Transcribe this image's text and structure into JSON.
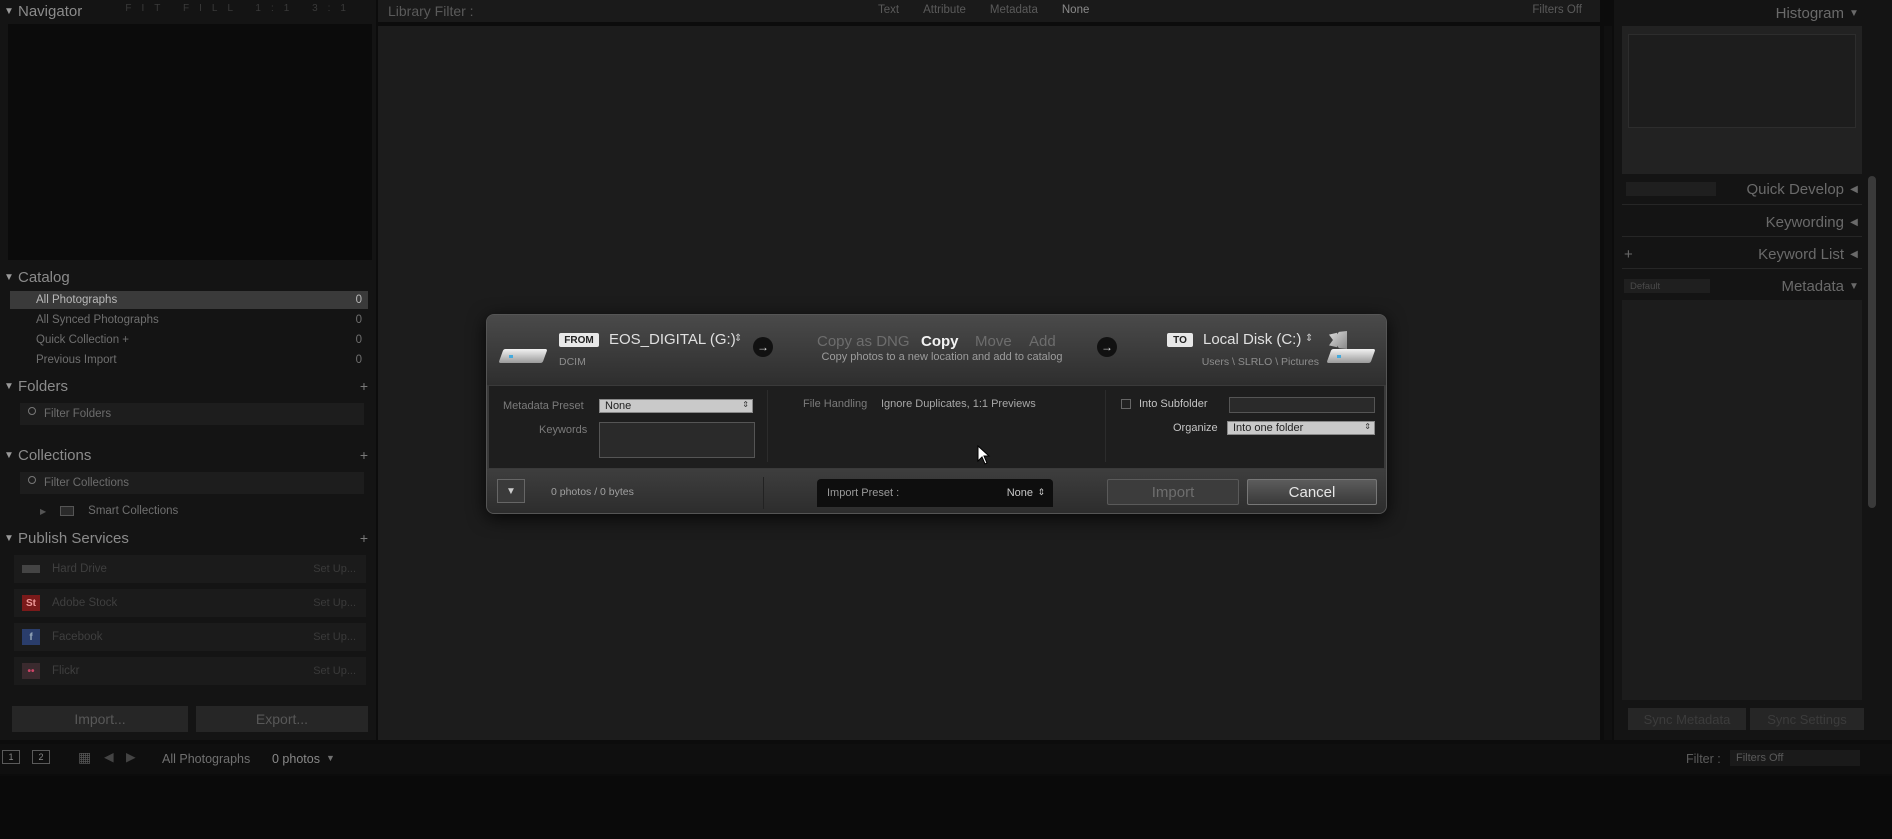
{
  "left_panel": {
    "navigator": {
      "title": "Navigator",
      "modes": "FIT FILL 1:1 3:1"
    },
    "catalog": {
      "title": "Catalog",
      "items": [
        {
          "label": "All Photographs",
          "count": "0"
        },
        {
          "label": "All Synced Photographs",
          "count": "0"
        },
        {
          "label": "Quick Collection +",
          "count": "0"
        },
        {
          "label": "Previous Import",
          "count": "0"
        }
      ]
    },
    "folders": {
      "title": "Folders",
      "filter_placeholder": "Filter Folders"
    },
    "collections": {
      "title": "Collections",
      "filter_placeholder": "Filter Collections",
      "smart_collections": "Smart Collections"
    },
    "publish_services": {
      "title": "Publish Services",
      "items": [
        {
          "label": "Hard Drive",
          "setup": "Set Up...",
          "icon": "HD",
          "color": "#555555"
        },
        {
          "label": "Adobe Stock",
          "setup": "Set Up...",
          "icon": "St",
          "color": "#8a2020"
        },
        {
          "label": "Facebook",
          "setup": "Set Up...",
          "icon": "f",
          "color": "#2a3d6b"
        },
        {
          "label": "Flickr",
          "setup": "Set Up...",
          "icon": "••",
          "color": "#6a2a3a"
        }
      ]
    },
    "import_button": "Import...",
    "export_button": "Export..."
  },
  "filter_bar": {
    "title": "Library Filter :",
    "tabs": [
      "Text",
      "Attribute",
      "Metadata",
      "None"
    ],
    "filters_off": "Filters Off"
  },
  "right_panel": {
    "histogram": "Histogram",
    "quick_develop": "Quick Develop",
    "keywording": "Keywording",
    "keyword_list": "Keyword List",
    "metadata": "Metadata",
    "metadata_preset": "Default",
    "sync_metadata": "Sync Metadata",
    "sync_settings": "Sync Settings"
  },
  "filmstrip": {
    "page1": "1",
    "page2": "2",
    "source": "All Photographs",
    "count": "0 photos",
    "filter_label": "Filter :",
    "filter_value": "Filters Off"
  },
  "import_dialog": {
    "from_tag": "FROM",
    "source_name": "EOS_DIGITAL (G:)",
    "source_path": "DCIM",
    "modes": [
      "Copy as DNG",
      "Copy",
      "Move",
      "Add"
    ],
    "mode_description": "Copy photos to a new location and add to catalog",
    "to_tag": "TO",
    "dest_name": "Local Disk (C:)",
    "dest_path": "Users \\ SLRLO \\ Pictures",
    "metadata_preset_label": "Metadata Preset",
    "metadata_preset_value": "None",
    "keywords_label": "Keywords",
    "file_handling_label": "File Handling",
    "file_handling_value": "Ignore Duplicates, 1:1 Previews",
    "into_subfolder_label": "Into Subfolder",
    "organize_label": "Organize",
    "organize_value": "Into one folder",
    "photo_count": "0 photos / 0 bytes",
    "import_preset_label": "Import Preset :",
    "import_preset_value": "None",
    "import_button": "Import",
    "cancel_button": "Cancel"
  }
}
